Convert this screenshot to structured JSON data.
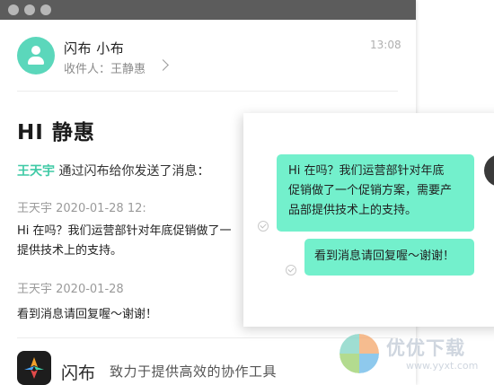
{
  "mail": {
    "sender": "闪布 小布",
    "recipient_label": "收件人：王静惠",
    "time": "13:08",
    "greeting": "HI 静惠",
    "intro_name": "王天宇",
    "intro_text": " 通过闪布给你发送了消息：",
    "messages": [
      {
        "meta": "王天宇    2020-01-28 12:",
        "lines": [
          "Hi 在吗？我们运营部针对年底促销做了一",
          "提供技术上的支持。"
        ]
      },
      {
        "meta": "王天宇    2020-01-28",
        "lines": [
          "看到消息请回复喔～谢谢！"
        ]
      }
    ]
  },
  "footer": {
    "brand": "闪布",
    "slogan": "致力于提供高效的协作工具"
  },
  "chat": {
    "bubble1_lines": [
      "Hi 在吗？我们运营部针对年底",
      "促销做了一个促销方案，需要产",
      "品部提供技术上的支持。"
    ],
    "bubble2": "看到消息请回复喔～谢谢！",
    "bubble_color": "#73f0cc"
  },
  "watermark": {
    "title": "优优下载",
    "url": "www.yyxt.com"
  },
  "colors": {
    "accent": "#5bd7bb",
    "name_highlight": "#3fcaa6"
  },
  "icons": [
    "person-icon",
    "chevron-right-icon",
    "read-receipt-icon",
    "shanbu-logo-icon",
    "watermark-logo-icon"
  ]
}
